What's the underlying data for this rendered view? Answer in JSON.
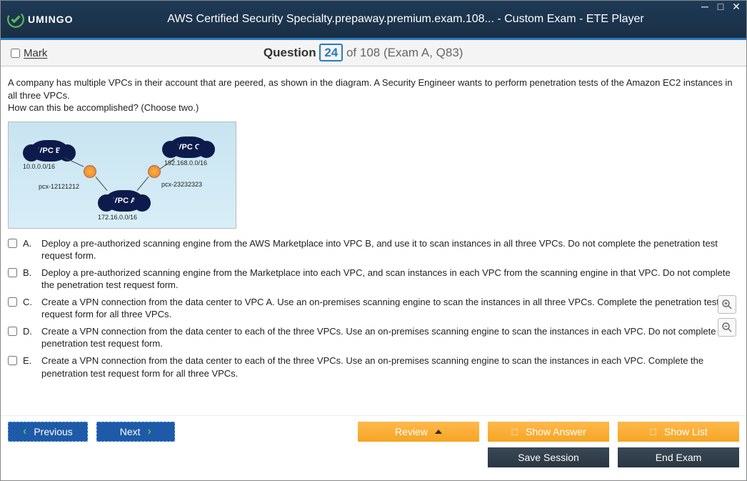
{
  "window": {
    "title": "AWS Certified Security Specialty.prepaway.premium.exam.108... - Custom Exam - ETE Player",
    "logo_text": "UMINGO"
  },
  "question_bar": {
    "mark_label": "Mark",
    "q_label": "Question",
    "q_number": "24",
    "q_of": "of 108 (Exam A, Q83)"
  },
  "question": {
    "text_line1": "A company has multiple VPCs in their account that are peered, as shown in the diagram. A Security Engineer wants to perform penetration tests of the Amazon EC2 instances in all three VPCs.",
    "text_line2": "How can this be accomplished? (Choose two.)"
  },
  "diagram": {
    "vpc_b": "VPC B",
    "vpc_b_cidr": "10.0.0.0/16",
    "vpc_c": "VPC C",
    "vpc_c_cidr": "192.168.0.0/16",
    "vpc_a": "VPC A",
    "vpc_a_cidr": "172.16.0.0/16",
    "pcx1": "pcx-12121212",
    "pcx2": "pcx-23232323"
  },
  "options": [
    {
      "letter": "A.",
      "text": "Deploy a pre-authorized scanning engine from the AWS Marketplace into VPC B, and use it to scan instances in all three VPCs. Do not complete the penetration test request form."
    },
    {
      "letter": "B.",
      "text": "Deploy a pre-authorized scanning engine from the Marketplace into each VPC, and scan instances in each VPC from the scanning engine in that VPC. Do not complete the penetration test request form."
    },
    {
      "letter": "C.",
      "text": "Create a VPN connection from the data center to VPC A. Use an on-premises scanning engine to scan the instances in all three VPCs. Complete the penetration test request form for all three VPCs."
    },
    {
      "letter": "D.",
      "text": "Create a VPN connection from the data center to each of the three VPCs. Use an on-premises scanning engine to scan the instances in each VPC. Do not complete the penetration test request form."
    },
    {
      "letter": "E.",
      "text": "Create a VPN connection from the data center to each of the three VPCs. Use an on-premises scanning engine to scan the instances in each VPC. Complete the penetration test request form for all three VPCs."
    }
  ],
  "buttons": {
    "previous": "Previous",
    "next": "Next",
    "review": "Review",
    "show_answer": "Show Answer",
    "show_list": "Show List",
    "save_session": "Save Session",
    "end_exam": "End Exam"
  }
}
